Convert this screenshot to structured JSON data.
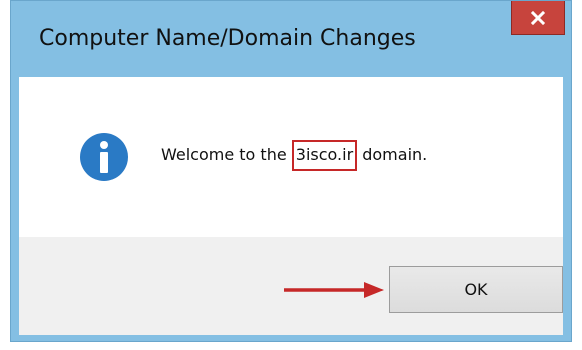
{
  "dialog": {
    "title": "Computer Name/Domain Changes",
    "close_icon": "close-icon",
    "info_icon": "information-icon",
    "message": {
      "prefix": "Welcome to the ",
      "domain": "3isco.ir",
      "suffix": " domain."
    },
    "ok_label": "OK"
  },
  "annotations": {
    "highlight_color": "#c62828",
    "arrow_icon": "right-arrow-icon"
  },
  "colors": {
    "frame": "#84bfe3",
    "close_button": "#c7443d",
    "info_icon": "#2a7ac5",
    "footer": "#f0f0f0"
  }
}
